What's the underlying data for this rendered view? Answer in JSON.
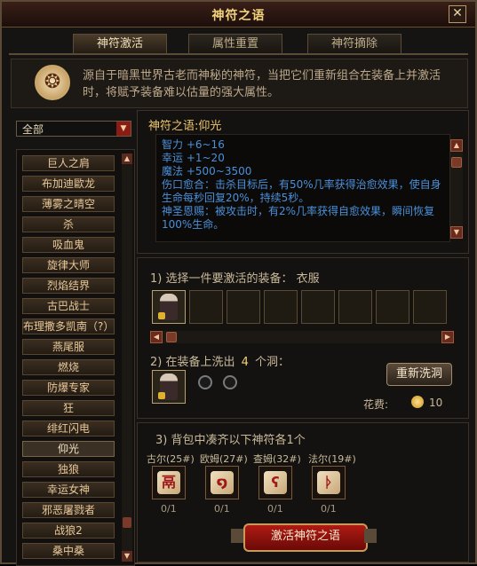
{
  "window": {
    "title": "神符之语"
  },
  "tabs": [
    {
      "label": "神符激活",
      "active": true
    },
    {
      "label": "属性重置",
      "active": false
    },
    {
      "label": "神符摘除",
      "active": false
    }
  ],
  "intro": {
    "icon": "rune-scroll-icon",
    "text": "源自于暗黑世界古老而神秘的神符，当把它们重新组合在装备上并激活时，将赋予装备难以估量的强大属性。"
  },
  "filter": {
    "selected": "全部"
  },
  "rune_words": [
    {
      "label": "巨人之肩",
      "selected": false
    },
    {
      "label": "布加迪歐龙",
      "selected": false
    },
    {
      "label": "薄雾之晴空",
      "selected": false
    },
    {
      "label": "杀",
      "selected": false
    },
    {
      "label": "吸血鬼",
      "selected": false
    },
    {
      "label": "旋律大师",
      "selected": false
    },
    {
      "label": "烈焰结界",
      "selected": false
    },
    {
      "label": "古巴战士",
      "selected": false
    },
    {
      "label": "布理撒多凯南（?）",
      "selected": false
    },
    {
      "label": "燕尾服",
      "selected": false
    },
    {
      "label": "燃烧",
      "selected": false
    },
    {
      "label": "防爆专家",
      "selected": false
    },
    {
      "label": "狂",
      "selected": false
    },
    {
      "label": "绯红闪电",
      "selected": false
    },
    {
      "label": "仰光",
      "selected": true
    },
    {
      "label": "独狼",
      "selected": false
    },
    {
      "label": "幸运女神",
      "selected": false
    },
    {
      "label": "邪恶屠戮者",
      "selected": false
    },
    {
      "label": "战狼2",
      "selected": false
    },
    {
      "label": "桑中桑",
      "selected": false
    }
  ],
  "detail": {
    "title": "神符之语:仰光",
    "lines": [
      "智力 +6~16",
      "幸运 +1~20",
      "魔法 +500~3500",
      "伤口愈合：击杀目标后，有50%几率获得治愈效果，使自身生命每秒回复20%，持续5秒。",
      "神圣恩赐：被攻击时，有2%几率获得自愈效果，瞬间恢复100%生命。"
    ]
  },
  "step1": {
    "label": "1) 选择一件要激活的装备：",
    "equip": "衣服"
  },
  "step2": {
    "prefix": "2) 在装备上洗出",
    "count": "4",
    "suffix": "个洞："
  },
  "rewash_button": "重新洗洞",
  "cost": {
    "label": "花费:",
    "value": "10"
  },
  "step3": {
    "label": "3) 背包中凑齐以下神符各1个"
  },
  "runes": [
    {
      "name": "古尔(25#)",
      "count": "0/1",
      "glyph": "鬲"
    },
    {
      "name": "欧姆(27#)",
      "count": "0/1",
      "glyph": "໑"
    },
    {
      "name": "查姆(32#)",
      "count": "0/1",
      "glyph": "ʕ"
    },
    {
      "name": "法尔(19#)",
      "count": "0/1",
      "glyph": "ᚦ"
    }
  ],
  "activate_button": "激活神符之语",
  "colors": {
    "accent": "#ecc66a",
    "desc_text": "#4a90d9",
    "button_red": "#b01a12"
  }
}
